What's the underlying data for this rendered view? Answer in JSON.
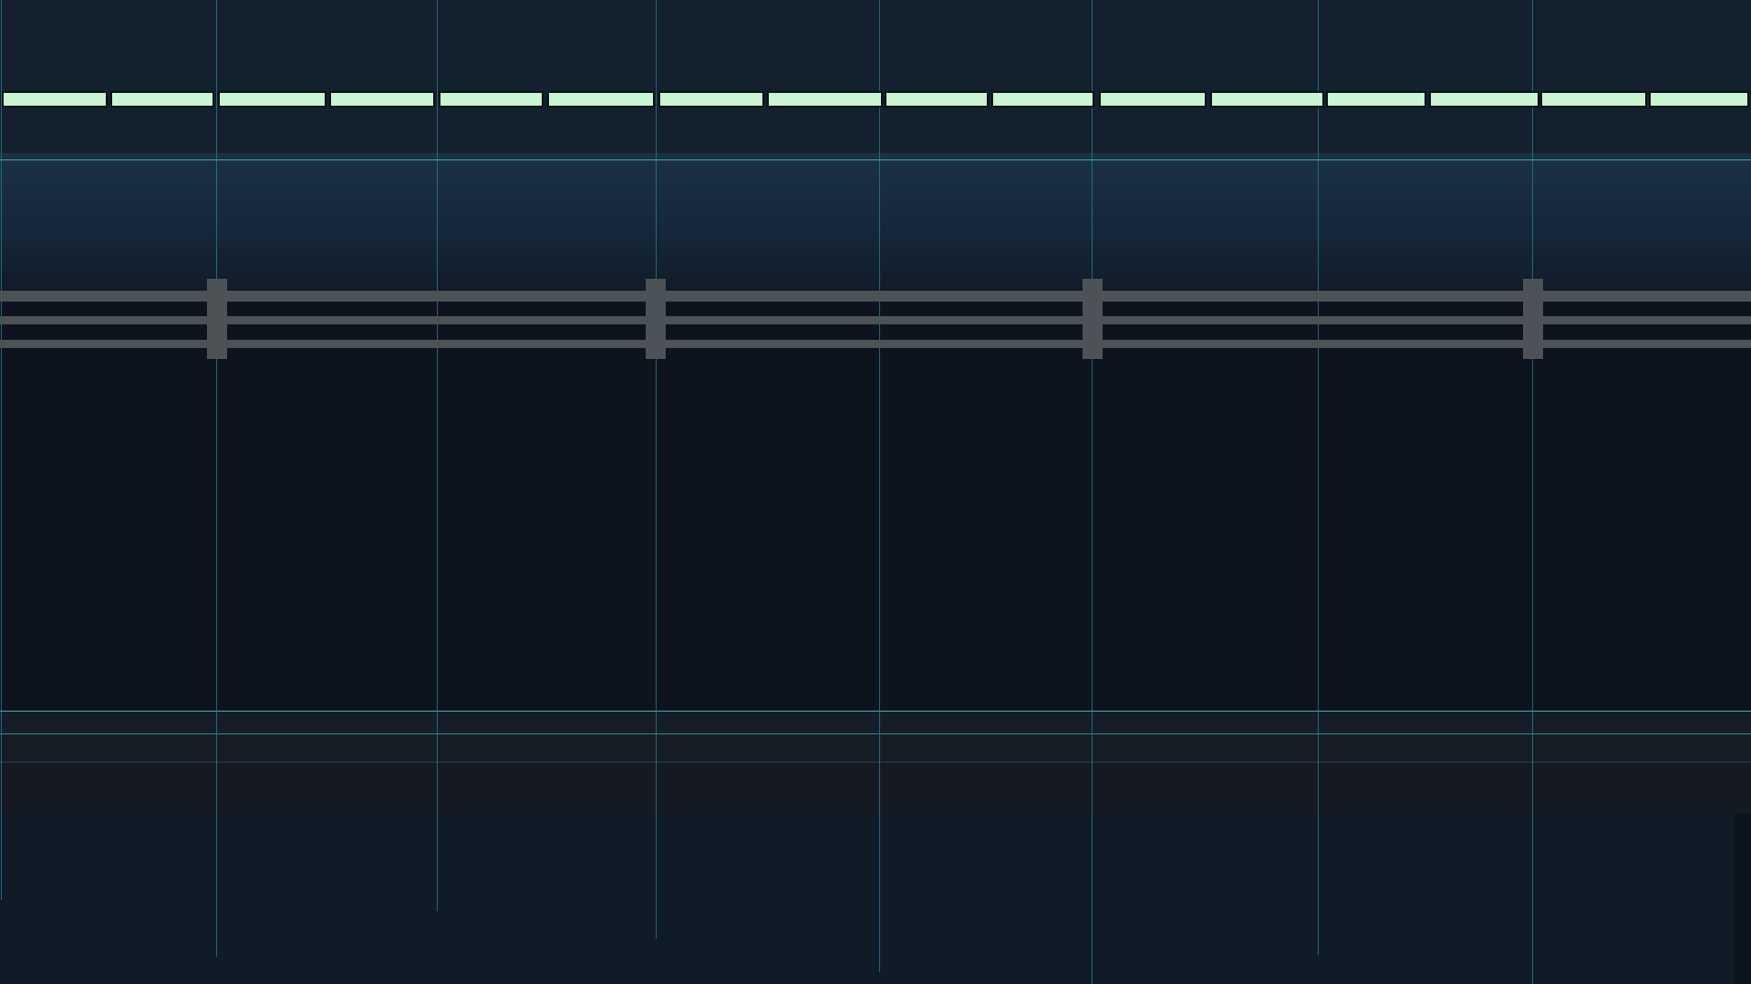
{
  "scene": {
    "colors": {
      "tile": "#c9f5d3",
      "grid_line": "#2f7f98",
      "rail": "#4d5256",
      "field": "#0d141e",
      "accent_line": "#45c2c9"
    },
    "tile_count": 16,
    "rail_count": 3,
    "post_count": 4,
    "grid_line_count": 8
  }
}
